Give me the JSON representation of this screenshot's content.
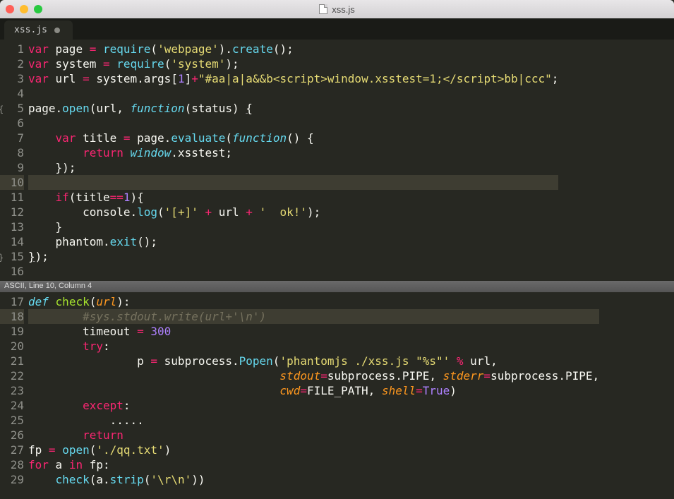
{
  "window": {
    "title": "xss.js"
  },
  "tab": {
    "label": "xss.js"
  },
  "statusbar": "ASCII, Line 10, Column 4",
  "pane1": {
    "lines": [
      {
        "n": "1",
        "fold": "",
        "tokens": [
          [
            "kw",
            "var"
          ],
          [
            "pl",
            " page "
          ],
          [
            "op",
            "="
          ],
          [
            "pl",
            " "
          ],
          [
            "fn",
            "require"
          ],
          [
            "pl",
            "("
          ],
          [
            "str",
            "'webpage'"
          ],
          [
            "pl",
            ")."
          ],
          [
            "fn",
            "create"
          ],
          [
            "pl",
            "();"
          ]
        ]
      },
      {
        "n": "2",
        "fold": "",
        "tokens": [
          [
            "kw",
            "var"
          ],
          [
            "pl",
            " system "
          ],
          [
            "op",
            "="
          ],
          [
            "pl",
            " "
          ],
          [
            "fn",
            "require"
          ],
          [
            "pl",
            "("
          ],
          [
            "str",
            "'system'"
          ],
          [
            "pl",
            ");"
          ]
        ]
      },
      {
        "n": "3",
        "fold": "",
        "tokens": [
          [
            "kw",
            "var"
          ],
          [
            "pl",
            " url "
          ],
          [
            "op",
            "="
          ],
          [
            "pl",
            " system.args["
          ],
          [
            "num",
            "1"
          ],
          [
            "pl",
            "]"
          ],
          [
            "op",
            "+"
          ],
          [
            "str",
            "\"#aa|a|a&&b<script>window.xsstest=1;</script>bb|ccc\""
          ],
          [
            "pl",
            ";"
          ]
        ]
      },
      {
        "n": "4",
        "fold": "",
        "tokens": [
          [
            "pl",
            ""
          ]
        ]
      },
      {
        "n": "5",
        "fold": "{",
        "tokens": [
          [
            "pl",
            "page."
          ],
          [
            "fn",
            "open"
          ],
          [
            "pl",
            "(url, "
          ],
          [
            "st",
            "function"
          ],
          [
            "pl",
            "(status) "
          ],
          [
            "pl u",
            "{"
          ]
        ]
      },
      {
        "n": "6",
        "fold": "",
        "tokens": [
          [
            "pl",
            ""
          ]
        ]
      },
      {
        "n": "7",
        "fold": "",
        "tokens": [
          [
            "pl",
            "    "
          ],
          [
            "kw",
            "var"
          ],
          [
            "pl",
            " title "
          ],
          [
            "op",
            "="
          ],
          [
            "pl",
            " page."
          ],
          [
            "fn",
            "evaluate"
          ],
          [
            "pl",
            "("
          ],
          [
            "st",
            "function"
          ],
          [
            "pl",
            "() {"
          ]
        ]
      },
      {
        "n": "8",
        "fold": "",
        "tokens": [
          [
            "pl",
            "        "
          ],
          [
            "kw",
            "return"
          ],
          [
            "pl",
            " "
          ],
          [
            "st",
            "window"
          ],
          [
            "pl",
            ".xsstest;"
          ]
        ]
      },
      {
        "n": "9",
        "fold": "",
        "tokens": [
          [
            "pl",
            "    });"
          ]
        ]
      },
      {
        "n": "10",
        "fold": "",
        "current": true,
        "tokens": [
          [
            "pl",
            "    "
          ]
        ]
      },
      {
        "n": "11",
        "fold": "",
        "tokens": [
          [
            "pl",
            "    "
          ],
          [
            "kw",
            "if"
          ],
          [
            "pl",
            "(title"
          ],
          [
            "op",
            "=="
          ],
          [
            "num",
            "1"
          ],
          [
            "pl",
            "){"
          ]
        ]
      },
      {
        "n": "12",
        "fold": "",
        "tokens": [
          [
            "pl",
            "        console."
          ],
          [
            "fn",
            "log"
          ],
          [
            "pl",
            "("
          ],
          [
            "str",
            "'[+]'"
          ],
          [
            "pl",
            " "
          ],
          [
            "op",
            "+"
          ],
          [
            "pl",
            " url "
          ],
          [
            "op",
            "+"
          ],
          [
            "pl",
            " "
          ],
          [
            "str",
            "'  ok!'"
          ],
          [
            "pl",
            ");"
          ]
        ]
      },
      {
        "n": "13",
        "fold": "",
        "tokens": [
          [
            "pl",
            "    }"
          ]
        ]
      },
      {
        "n": "14",
        "fold": "",
        "tokens": [
          [
            "pl",
            "    phantom."
          ],
          [
            "fn",
            "exit"
          ],
          [
            "pl",
            "();"
          ]
        ]
      },
      {
        "n": "15",
        "fold": "}",
        "tokens": [
          [
            "pl u",
            "}"
          ],
          [
            "pl",
            ");"
          ]
        ]
      },
      {
        "n": "16",
        "fold": "",
        "tokens": [
          [
            "pl",
            ""
          ]
        ]
      }
    ]
  },
  "pane2": {
    "lines": [
      {
        "n": "17",
        "fold": "",
        "tokens": [
          [
            "st",
            "def"
          ],
          [
            "pl",
            " "
          ],
          [
            "nm",
            "check"
          ],
          [
            "pl",
            "("
          ],
          [
            "arg",
            "url"
          ],
          [
            "pl",
            "):"
          ]
        ]
      },
      {
        "n": "18",
        "fold": "",
        "current": true,
        "tokens": [
          [
            "pl",
            "        "
          ],
          [
            "cm",
            "#sys.stdout.write(url+'\\n')"
          ]
        ]
      },
      {
        "n": "19",
        "fold": "",
        "tokens": [
          [
            "pl",
            "        timeout "
          ],
          [
            "op",
            "="
          ],
          [
            "pl",
            " "
          ],
          [
            "num",
            "300"
          ]
        ]
      },
      {
        "n": "20",
        "fold": "",
        "tokens": [
          [
            "pl",
            "        "
          ],
          [
            "kw",
            "try"
          ],
          [
            "pl",
            ":"
          ]
        ]
      },
      {
        "n": "21",
        "fold": "",
        "tokens": [
          [
            "pl",
            "                p "
          ],
          [
            "op",
            "="
          ],
          [
            "pl",
            " subprocess."
          ],
          [
            "fn",
            "Popen"
          ],
          [
            "pl",
            "("
          ],
          [
            "str",
            "'phantomjs ./xss.js \"%s\"'"
          ],
          [
            "pl",
            " "
          ],
          [
            "op",
            "%"
          ],
          [
            "pl",
            " url,"
          ]
        ]
      },
      {
        "n": "22",
        "fold": "",
        "tokens": [
          [
            "pl",
            "                                     "
          ],
          [
            "arg",
            "stdout"
          ],
          [
            "op",
            "="
          ],
          [
            "pl",
            "subprocess.PIPE, "
          ],
          [
            "arg",
            "stderr"
          ],
          [
            "op",
            "="
          ],
          [
            "pl",
            "subprocess.PIPE,"
          ]
        ]
      },
      {
        "n": "23",
        "fold": "",
        "tokens": [
          [
            "pl",
            "                                     "
          ],
          [
            "arg",
            "cwd"
          ],
          [
            "op",
            "="
          ],
          [
            "pl",
            "FILE_PATH, "
          ],
          [
            "arg",
            "shell"
          ],
          [
            "op",
            "="
          ],
          [
            "num",
            "True"
          ],
          [
            "pl",
            ")"
          ]
        ]
      },
      {
        "n": "24",
        "fold": "",
        "tokens": [
          [
            "pl",
            "        "
          ],
          [
            "kw",
            "except"
          ],
          [
            "pl",
            ":"
          ]
        ]
      },
      {
        "n": "25",
        "fold": "",
        "tokens": [
          [
            "pl",
            "            ....."
          ]
        ]
      },
      {
        "n": "26",
        "fold": "",
        "tokens": [
          [
            "pl",
            "        "
          ],
          [
            "kw",
            "return"
          ]
        ]
      },
      {
        "n": "27",
        "fold": "",
        "tokens": [
          [
            "pl",
            "fp "
          ],
          [
            "op",
            "="
          ],
          [
            "pl",
            " "
          ],
          [
            "fn",
            "open"
          ],
          [
            "pl",
            "("
          ],
          [
            "str",
            "'./qq.txt'"
          ],
          [
            "pl",
            ")"
          ]
        ]
      },
      {
        "n": "28",
        "fold": "",
        "tokens": [
          [
            "kw",
            "for"
          ],
          [
            "pl",
            " a "
          ],
          [
            "kw",
            "in"
          ],
          [
            "pl",
            " fp:"
          ]
        ]
      },
      {
        "n": "29",
        "fold": "",
        "tokens": [
          [
            "pl",
            "    "
          ],
          [
            "fn",
            "check"
          ],
          [
            "pl",
            "(a."
          ],
          [
            "fn",
            "strip"
          ],
          [
            "pl",
            "("
          ],
          [
            "str",
            "'\\r\\n'"
          ],
          [
            "pl",
            "))"
          ]
        ]
      }
    ]
  }
}
